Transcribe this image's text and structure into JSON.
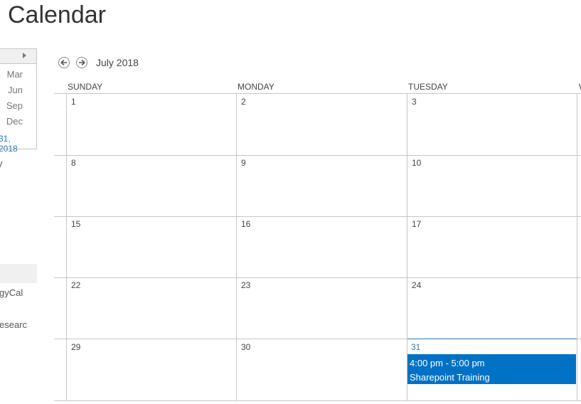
{
  "page": {
    "title": "Calendar"
  },
  "mini_calendar": {
    "months": [
      "Mar",
      "Jun",
      "Sep",
      "Dec"
    ],
    "date_range_fragment": "31, 2018"
  },
  "left_nav": {
    "items": [
      "y",
      "gyCal",
      "esearc"
    ]
  },
  "calendar": {
    "month_label": "July 2018",
    "day_headers": [
      "SUNDAY",
      "MONDAY",
      "TUESDAY",
      "W"
    ],
    "weeks": [
      [
        "1",
        "2",
        "3"
      ],
      [
        "8",
        "9",
        "10"
      ],
      [
        "15",
        "16",
        "17"
      ],
      [
        "22",
        "23",
        "24"
      ],
      [
        "29",
        "30",
        "31"
      ]
    ],
    "event": {
      "time": "4:00 pm - 5:00 pm",
      "title": "Sharepoint Training"
    }
  },
  "colors": {
    "accent": "#0072c6",
    "link": "#2a7ab5",
    "grid": "#c6c6c6"
  }
}
